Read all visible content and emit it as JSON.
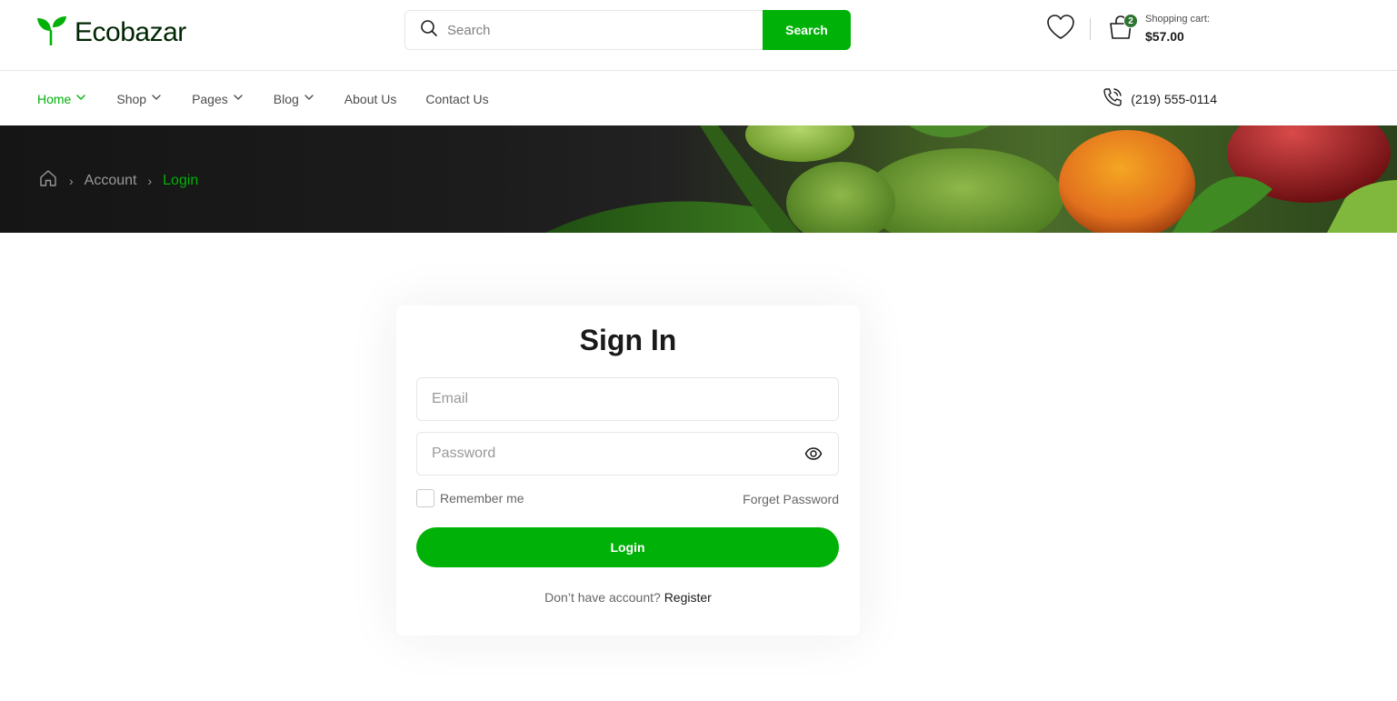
{
  "header": {
    "logo_text": "Ecobazar",
    "search": {
      "placeholder": "Search",
      "button_label": "Search"
    },
    "cart": {
      "badge_count": "2",
      "label": "Shopping cart:",
      "total": "$57.00"
    }
  },
  "nav": {
    "items": [
      {
        "label": "Home",
        "has_dropdown": true,
        "active": true
      },
      {
        "label": "Shop",
        "has_dropdown": true
      },
      {
        "label": "Pages",
        "has_dropdown": true
      },
      {
        "label": "Blog",
        "has_dropdown": true
      },
      {
        "label": "About Us",
        "has_dropdown": false
      },
      {
        "label": "Contact Us",
        "has_dropdown": false
      }
    ],
    "phone": "(219) 555-0114"
  },
  "breadcrumb": {
    "items": [
      "Account",
      "Login"
    ]
  },
  "signin": {
    "title": "Sign In",
    "email_placeholder": "Email",
    "password_placeholder": "Password",
    "remember_label": "Remember me",
    "forget_label": "Forget Password",
    "login_label": "Login",
    "no_account_text": "Don’t have account?",
    "register_label": "Register"
  },
  "colors": {
    "brand_green": "#00b207",
    "dark_green": "#2c742f",
    "logo_text": "#002603"
  },
  "icons": [
    "leaf-logo-icon",
    "search-icon",
    "heart-icon",
    "shopping-bag-icon",
    "chevron-down-icon",
    "phone-icon",
    "home-icon",
    "eye-icon"
  ]
}
